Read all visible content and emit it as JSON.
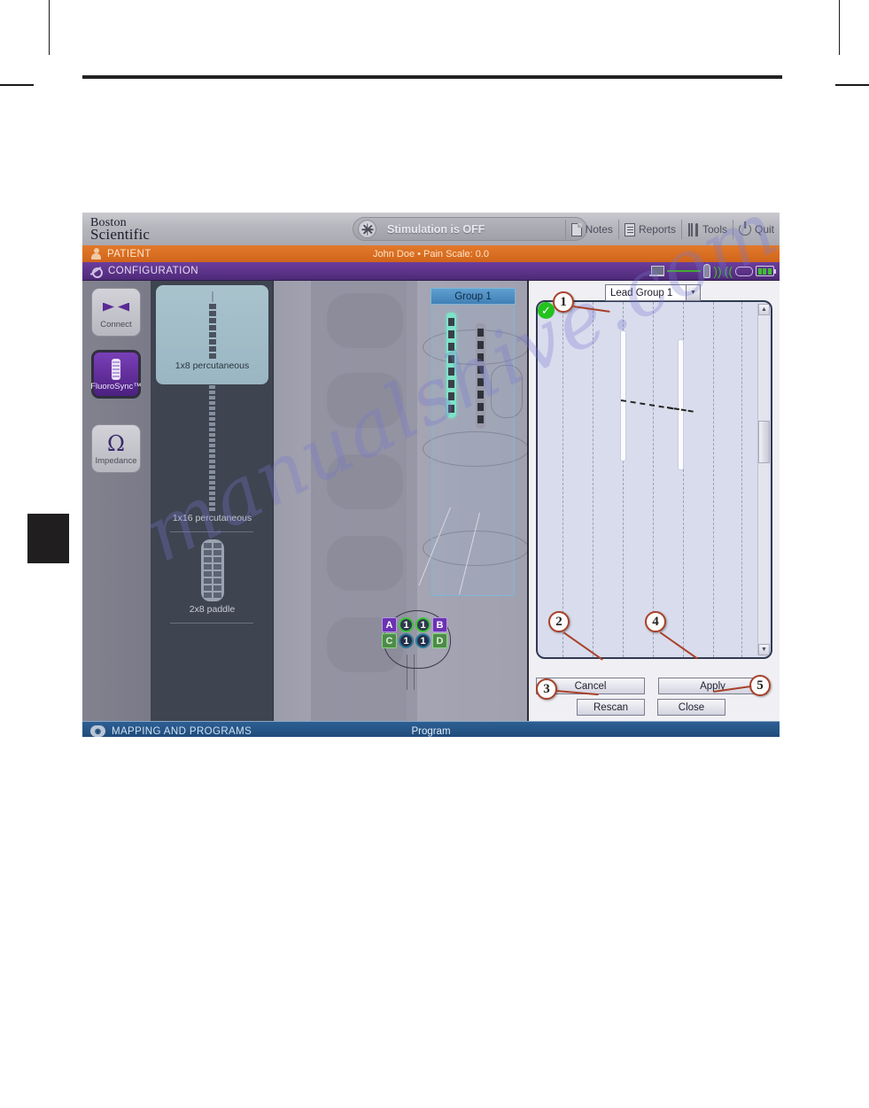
{
  "page": {
    "watermark": "manualshive.com"
  },
  "app": {
    "brand": {
      "line1": "Boston",
      "line2": "Scientific"
    },
    "stimulation": {
      "status_text": "Stimulation is OFF",
      "icon": "burst-icon"
    },
    "topmenu": [
      {
        "label": "Notes",
        "icon": "notes-icon"
      },
      {
        "label": "Reports",
        "icon": "reports-icon"
      },
      {
        "label": "Tools",
        "icon": "tools-icon"
      },
      {
        "label": "Quit",
        "icon": "power-icon"
      }
    ],
    "patient_bar": {
      "section_label": "PATIENT",
      "info": "John Doe  •  Pain Scale: 0.0",
      "icon": "person-icon"
    },
    "config_bar": {
      "section_label": "CONFIGURATION",
      "icon": "configuration-icon",
      "status_icons": [
        "laptop-icon",
        "link-line",
        "wand-icon",
        "signal-waves-icon",
        "signal-waves-icon",
        "ipg-icon",
        "battery-icon"
      ]
    },
    "rail": [
      {
        "id": "connect",
        "label": "Connect",
        "icon": "connect-icon",
        "active": false
      },
      {
        "id": "fluorosync",
        "label": "FluoroSync™",
        "icon": "lead-icon",
        "active": true
      },
      {
        "id": "impedance",
        "label": "Impedance",
        "icon": "omega-icon",
        "active": false
      }
    ],
    "lead_picker": [
      {
        "label": "1x8 percutaneous",
        "selected": true
      },
      {
        "label": "1x16 percutaneous",
        "selected": false
      },
      {
        "label": "2x8 paddle",
        "selected": false
      }
    ],
    "anatomy": {
      "group_tab_label": "Group 1",
      "contacts": {
        "row_top": [
          "A",
          "1",
          "1",
          "B"
        ],
        "row_bottom": [
          "C",
          "1",
          "1",
          "D"
        ]
      }
    },
    "fluoro_panel": {
      "dropdown": {
        "value": "Lead Group 1",
        "icon": "chevron-down-icon"
      },
      "scrollbar": {
        "up_icon": "chevron-up-icon",
        "down_icon": "chevron-down-icon"
      },
      "status_marker": "check-icon",
      "buttons": [
        {
          "id": "cancel",
          "label": "Cancel"
        },
        {
          "id": "apply",
          "label": "Apply"
        },
        {
          "id": "rescan",
          "label": "Rescan"
        },
        {
          "id": "close",
          "label": "Close"
        }
      ]
    },
    "bottom_bar": {
      "section_label": "MAPPING AND PROGRAMS",
      "center_label": "Program",
      "icon": "mapping-icon"
    }
  },
  "callouts": [
    {
      "number": "1"
    },
    {
      "number": "2"
    },
    {
      "number": "3"
    },
    {
      "number": "4"
    },
    {
      "number": "5"
    }
  ],
  "colors": {
    "orange_bar": "#d0651b",
    "purple_bar": "#4e2a78",
    "blue_bar": "#1d4775",
    "callout": "#a8412a",
    "accent_teal": "#7ee2c8",
    "status_green": "#23c21f"
  }
}
